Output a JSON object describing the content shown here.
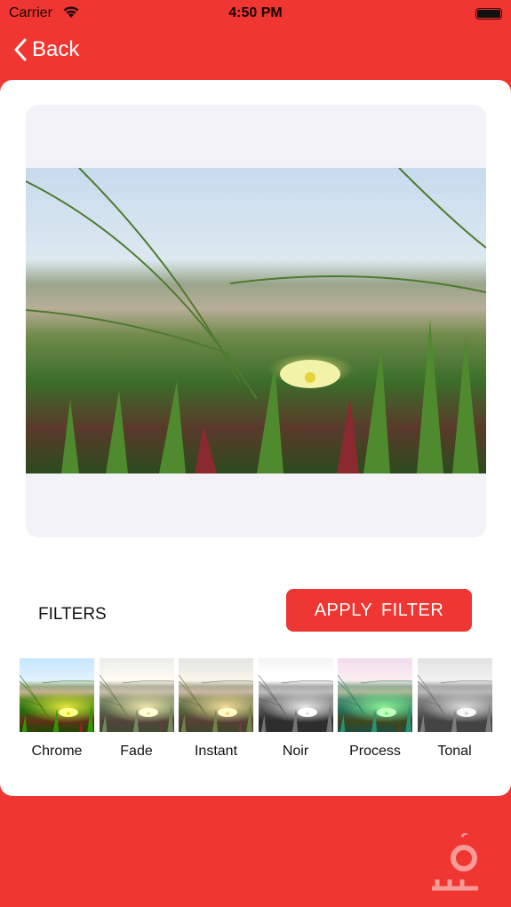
{
  "status": {
    "carrier": "Carrier",
    "time": "4:50 PM"
  },
  "nav": {
    "back_label": "Back"
  },
  "filters": {
    "title": "FILTERS",
    "apply_label": "APPLY  FILTER",
    "items": [
      {
        "label": "Chrome",
        "css": "saturate(1.4) contrast(1.1)"
      },
      {
        "label": "Fade",
        "css": "saturate(.5) sepia(.2) brightness(1.05)"
      },
      {
        "label": "Instant",
        "css": "sepia(.3) saturate(.8) hue-rotate(-10deg)"
      },
      {
        "label": "Noir",
        "css": "grayscale(1) contrast(1.3)"
      },
      {
        "label": "Process",
        "css": "hue-rotate(60deg) saturate(1.2) sepia(.2)"
      },
      {
        "label": "Tonal",
        "css": "grayscale(1) brightness(1.05)"
      }
    ]
  },
  "colors": {
    "accent": "#f03631",
    "panel": "#f2f2f7"
  }
}
